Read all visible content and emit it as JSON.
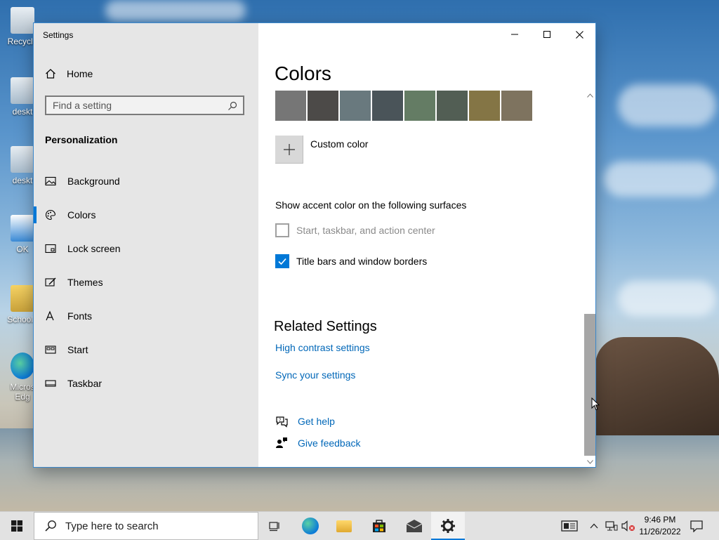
{
  "desktop": {
    "icons": [
      {
        "label": "Recycle"
      },
      {
        "label": "deskt"
      },
      {
        "label": "deskt"
      },
      {
        "label": "OK"
      },
      {
        "label": "School I"
      },
      {
        "label": "Micros Edg"
      }
    ]
  },
  "window": {
    "title": "Settings",
    "controls": {
      "minimize": "minimize-icon",
      "maximize": "maximize-icon",
      "close": "close-icon"
    }
  },
  "sidebar": {
    "home_label": "Home",
    "search_placeholder": "Find a setting",
    "section_title": "Personalization",
    "items": [
      {
        "label": "Background",
        "icon": "picture-icon"
      },
      {
        "label": "Colors",
        "icon": "palette-icon",
        "active": true
      },
      {
        "label": "Lock screen",
        "icon": "lock-screen-icon"
      },
      {
        "label": "Themes",
        "icon": "themes-icon"
      },
      {
        "label": "Fonts",
        "icon": "fonts-icon"
      },
      {
        "label": "Start",
        "icon": "start-icon"
      },
      {
        "label": "Taskbar",
        "icon": "taskbar-icon"
      }
    ]
  },
  "main": {
    "title": "Colors",
    "swatches": [
      "#767676",
      "#4c4a48",
      "#69797e",
      "#4a5459",
      "#647c64",
      "#525e54",
      "#847545",
      "#7e735f"
    ],
    "custom_color_label": "Custom color",
    "surfaces_label": "Show accent color on the following surfaces",
    "checkbox_start": {
      "label": "Start, taskbar, and action center",
      "checked": false,
      "disabled": true
    },
    "checkbox_title_bars": {
      "label": "Title bars and window borders",
      "checked": true
    },
    "related_title": "Related Settings",
    "link_high_contrast": "High contrast settings",
    "link_sync": "Sync your settings",
    "get_help": "Get help",
    "give_feedback": "Give feedback"
  },
  "taskbar": {
    "search_placeholder": "Type here to search",
    "time": "9:46 PM",
    "date": "11/26/2022"
  },
  "colors": {
    "accent": "#0078d7",
    "link": "#0067b8",
    "sidebar_bg": "#e6e6e6"
  }
}
